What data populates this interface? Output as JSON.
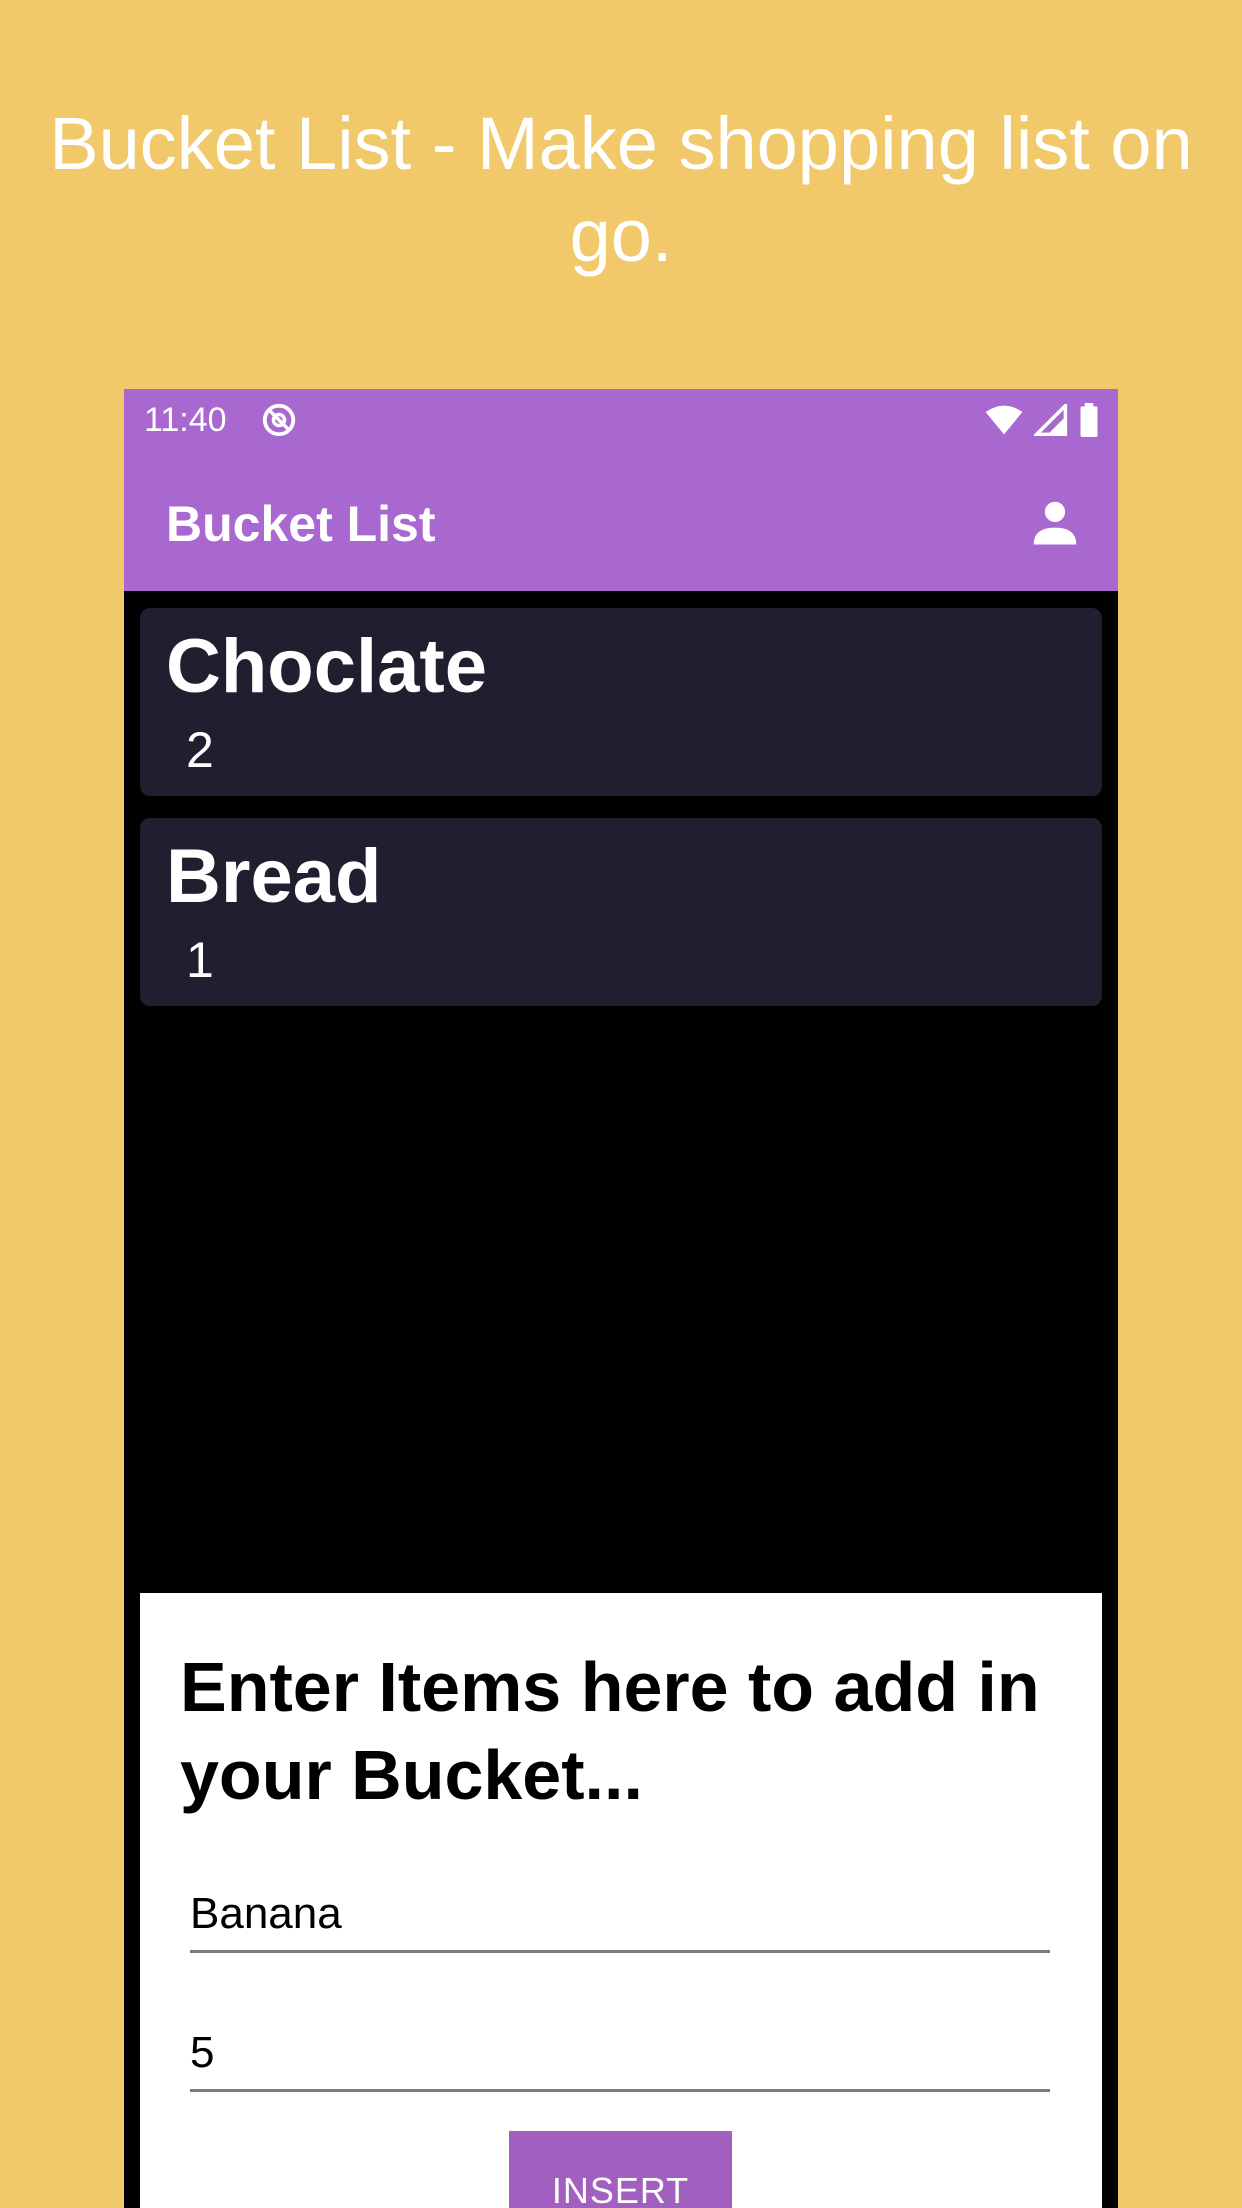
{
  "headline": "Bucket List - Make shopping list on go.",
  "status_bar": {
    "time": "11:40",
    "icons": [
      "app-notification-icon",
      "wifi-icon",
      "signal-icon",
      "battery-icon"
    ]
  },
  "app_bar": {
    "title": "Bucket List",
    "account_icon": "account-icon"
  },
  "items": [
    {
      "name": "Choclate",
      "quantity": "2"
    },
    {
      "name": "Bread",
      "quantity": "1"
    }
  ],
  "form": {
    "heading": "Enter Items here to add in your Bucket...",
    "item_field_value": "Banana",
    "quantity_field_value": "5",
    "insert_label": "INSERT"
  },
  "colors": {
    "background": "#F1C96B",
    "app_bar": "#A967D0",
    "card": "#201F30",
    "button": "#A15FC0"
  }
}
